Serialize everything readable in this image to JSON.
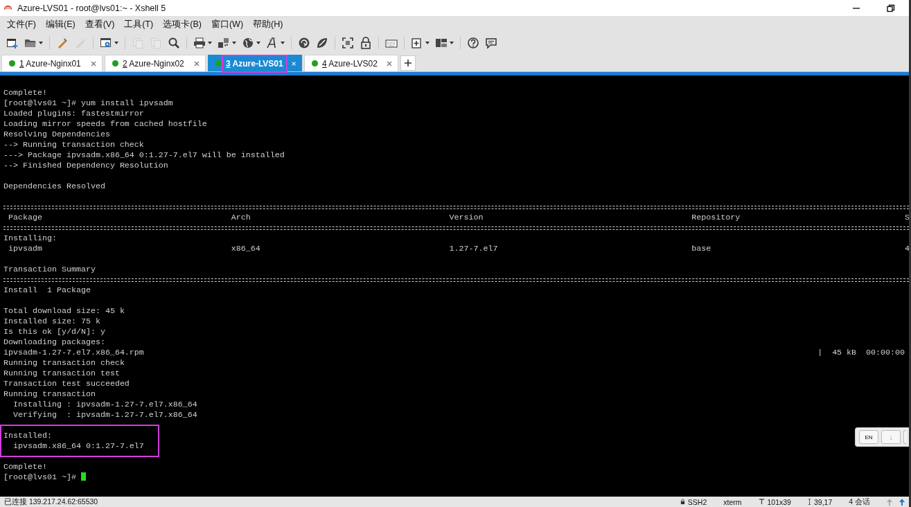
{
  "window": {
    "title": "Azure-LVS01 - root@lvs01:~ - Xshell 5"
  },
  "menu": [
    "文件(F)",
    "编辑(E)",
    "查看(V)",
    "工具(T)",
    "选项卡(B)",
    "窗口(W)",
    "帮助(H)"
  ],
  "toolbar": [
    {
      "kind": "new-session",
      "disabled": false,
      "dropdown": false
    },
    {
      "kind": "folder",
      "disabled": false,
      "dropdown": true
    },
    {
      "kind": "separator"
    },
    {
      "kind": "connect",
      "disabled": false,
      "dropdown": false
    },
    {
      "kind": "connect",
      "disabled": true,
      "dropdown": false
    },
    {
      "kind": "separator"
    },
    {
      "kind": "properties",
      "disabled": false,
      "dropdown": true
    },
    {
      "kind": "separator"
    },
    {
      "kind": "copy",
      "disabled": true,
      "dropdown": false
    },
    {
      "kind": "copy",
      "disabled": true,
      "dropdown": false
    },
    {
      "kind": "search",
      "disabled": false,
      "dropdown": false
    },
    {
      "kind": "separator"
    },
    {
      "kind": "printer",
      "disabled": false,
      "dropdown": true
    },
    {
      "kind": "transfer",
      "disabled": false,
      "dropdown": true
    },
    {
      "kind": "globe",
      "disabled": false,
      "dropdown": true
    },
    {
      "kind": "font",
      "disabled": false,
      "dropdown": true
    },
    {
      "kind": "separator"
    },
    {
      "kind": "spiral",
      "disabled": false,
      "dropdown": false
    },
    {
      "kind": "leaf",
      "disabled": false,
      "dropdown": false
    },
    {
      "kind": "separator"
    },
    {
      "kind": "fullscreen",
      "disabled": false,
      "dropdown": false
    },
    {
      "kind": "lock",
      "disabled": false,
      "dropdown": false
    },
    {
      "kind": "separator"
    },
    {
      "kind": "keyboard",
      "disabled": false,
      "dropdown": false
    },
    {
      "kind": "separator"
    },
    {
      "kind": "new-tab",
      "disabled": false,
      "dropdown": true
    },
    {
      "kind": "layout",
      "disabled": false,
      "dropdown": true
    },
    {
      "kind": "separator"
    },
    {
      "kind": "help",
      "disabled": false,
      "dropdown": false
    },
    {
      "kind": "chat",
      "disabled": false,
      "dropdown": false
    }
  ],
  "tabs": [
    {
      "number": "1",
      "label": "Azure-Nginx01",
      "selected": false,
      "connected": true,
      "highlighted": false
    },
    {
      "number": "2",
      "label": "Azure-Nginx02",
      "selected": false,
      "connected": true,
      "highlighted": false
    },
    {
      "number": "3",
      "label": "Azure-LVS01",
      "selected": true,
      "connected": true,
      "highlighted": true
    },
    {
      "number": "4",
      "label": "Azure-LVS02",
      "selected": false,
      "connected": true,
      "highlighted": false
    }
  ],
  "terminal": {
    "blocks": [
      {
        "highlighted": false,
        "lines": [
          {
            "kind": "text",
            "text": "Complete!"
          },
          {
            "kind": "text",
            "text": "[root@lvs01 ~]# yum install ipvsadm"
          },
          {
            "kind": "text",
            "text": "Loaded plugins: fastestmirror"
          },
          {
            "kind": "text",
            "text": "Loading mirror speeds from cached hostfile"
          },
          {
            "kind": "text",
            "text": "Resolving Dependencies"
          },
          {
            "kind": "text",
            "text": "--> Running transaction check"
          },
          {
            "kind": "text",
            "text": "---> Package ipvsadm.x86_64 0:1.27-7.el7 will be installed"
          },
          {
            "kind": "text",
            "text": "--> Finished Dependency Resolution"
          }
        ]
      },
      {
        "highlighted": false,
        "lines": [
          {
            "kind": "text",
            "text": "Dependencies Resolved"
          }
        ]
      },
      {
        "highlighted": false,
        "lines": [
          {
            "kind": "rule"
          },
          {
            "kind": "columns",
            "cells": [
              "Package",
              "Arch",
              "Version",
              "Repository",
              "S"
            ]
          },
          {
            "kind": "rule"
          },
          {
            "kind": "text",
            "text": "Installing:"
          },
          {
            "kind": "columns",
            "cells": [
              "ipvsadm",
              "x86_64",
              "1.27-7.el7",
              "base",
              "4"
            ]
          }
        ]
      },
      {
        "highlighted": false,
        "lines": [
          {
            "kind": "text",
            "text": "Transaction Summary"
          },
          {
            "kind": "rule"
          },
          {
            "kind": "text",
            "text": "Install  1 Package"
          }
        ]
      },
      {
        "highlighted": false,
        "lines": [
          {
            "kind": "text",
            "text": "Total download size: 45 k"
          },
          {
            "kind": "text",
            "text": "Installed size: 75 k"
          },
          {
            "kind": "text",
            "text": "Is this ok [y/d/N]: y"
          },
          {
            "kind": "text",
            "text": "Downloading packages:"
          },
          {
            "kind": "download",
            "text": "ipvsadm-1.27-7.el7.x86_64.rpm",
            "progress": "|  45 kB  00:00:00"
          },
          {
            "kind": "text",
            "text": "Running transaction check"
          },
          {
            "kind": "text",
            "text": "Running transaction test"
          },
          {
            "kind": "text",
            "text": "Transaction test succeeded"
          },
          {
            "kind": "text",
            "text": "Running transaction"
          },
          {
            "kind": "text",
            "text": "  Installing : ipvsadm-1.27-7.el7.x86_64"
          },
          {
            "kind": "text",
            "text": "  Verifying  : ipvsadm-1.27-7.el7.x86_64"
          }
        ]
      },
      {
        "highlighted": true,
        "lines": [
          {
            "kind": "text",
            "text": "Installed:"
          },
          {
            "kind": "text",
            "text": "  ipvsadm.x86_64 0:1.27-7.el7"
          }
        ]
      },
      {
        "highlighted": false,
        "lines": [
          {
            "kind": "text",
            "text": "Complete!"
          },
          {
            "kind": "text",
            "text": "[root@lvs01 ~]# ",
            "cursor": true
          }
        ]
      }
    ]
  },
  "ime_bar": [
    "EN",
    ";"
  ],
  "status_bar": {
    "connection": "已连接 139.217.24.62:65530",
    "items": [
      {
        "kind": "lock",
        "text": "SSH2"
      },
      {
        "kind": "plain",
        "text": "xterm"
      },
      {
        "kind": "size",
        "text": "101x39"
      },
      {
        "kind": "cursor",
        "text": "39,17"
      },
      {
        "kind": "plain",
        "text": "4 会话"
      }
    ]
  }
}
